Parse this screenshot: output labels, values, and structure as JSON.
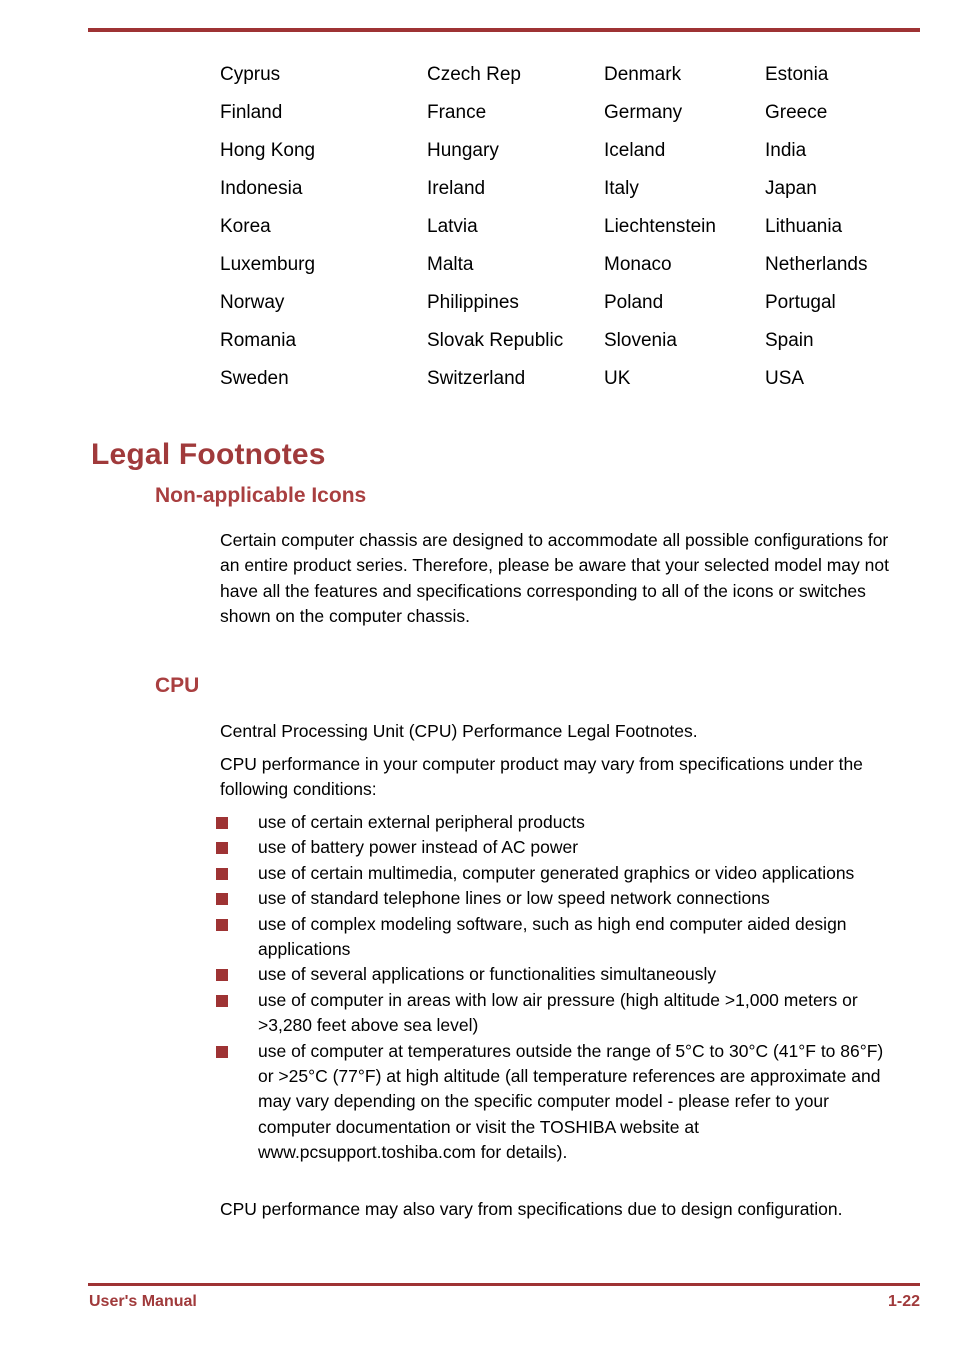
{
  "page": {
    "rule_color": "#9E3334",
    "heading_color": "#A03A3B",
    "bullet_color": "#9E3334"
  },
  "country_table": {
    "rows": [
      [
        "Cyprus",
        "Czech Rep",
        "Denmark",
        "Estonia"
      ],
      [
        "Finland",
        "France",
        "Germany",
        "Greece"
      ],
      [
        "Hong Kong",
        "Hungary",
        "Iceland",
        "India"
      ],
      [
        "Indonesia",
        "Ireland",
        "Italy",
        "Japan"
      ],
      [
        "Korea",
        "Latvia",
        "Liechtenstein",
        "Lithuania"
      ],
      [
        "Luxemburg",
        "Malta",
        "Monaco",
        "Netherlands"
      ],
      [
        "Norway",
        "Philippines",
        "Poland",
        "Portugal"
      ],
      [
        "Romania",
        "Slovak Republic",
        "Slovenia",
        "Spain"
      ],
      [
        "Sweden",
        "Switzerland",
        "UK",
        "USA"
      ]
    ]
  },
  "sections": {
    "legal_footnotes_title": "Legal Footnotes",
    "non_applicable_icons": {
      "title": "Non-applicable Icons",
      "paragraph": "Certain computer chassis are designed to accommodate all possible configurations for an entire product series. Therefore, please be aware that your selected model may not have all the features and specifications corresponding to all of the icons or switches shown on the computer chassis."
    },
    "cpu": {
      "title": "CPU",
      "paragraph_1": "Central Processing Unit (CPU) Performance Legal Footnotes.",
      "paragraph_2": "CPU performance in your computer product may vary from specifications under the following conditions:",
      "bullets": [
        "use of certain external peripheral products",
        "use of battery power instead of AC power",
        "use of certain multimedia, computer generated graphics or video applications",
        "use of standard telephone lines or low speed network connections",
        "use of complex modeling software, such as high end computer aided design applications",
        "use of several applications or functionalities simultaneously",
        "use of computer in areas with low air pressure (high altitude >1,000 meters or >3,280 feet above sea level)",
        "use of computer at temperatures outside the range of 5°C to 30°C (41°F to 86°F) or >25°C (77°F) at high altitude (all temperature references are approximate and may vary depending on the specific computer model - please refer to your computer documentation or visit the TOSHIBA website at www.pcsupport.toshiba.com for details)."
      ],
      "paragraph_3": "CPU performance may also vary from specifications due to design configuration."
    }
  },
  "footer": {
    "left": "User's Manual",
    "right": "1-22"
  }
}
